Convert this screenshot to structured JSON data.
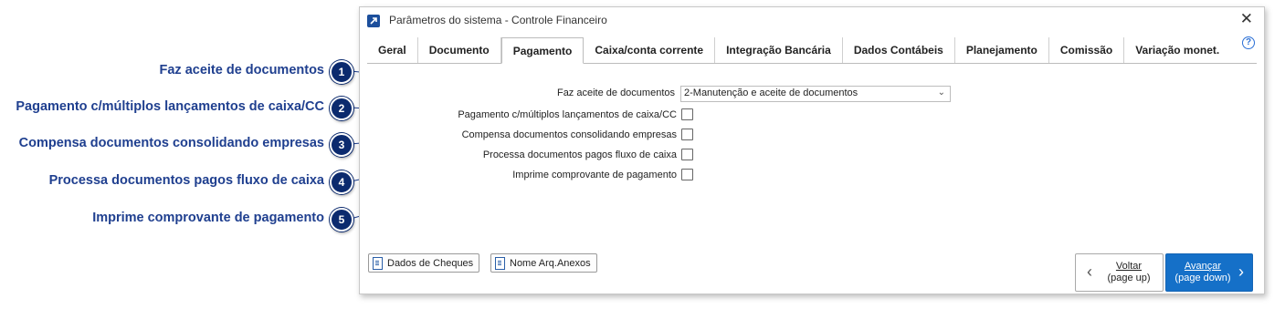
{
  "callouts": [
    {
      "number": "1",
      "label": "Faz aceite de documentos"
    },
    {
      "number": "2",
      "label": "Pagamento c/múltiplos lançamentos de caixa/CC"
    },
    {
      "number": "3",
      "label": "Compensa documentos consolidando empresas"
    },
    {
      "number": "4",
      "label": "Processa documentos pagos fluxo de caixa"
    },
    {
      "number": "5",
      "label": "Imprime comprovante de pagamento"
    }
  ],
  "window": {
    "title": "Parâmetros do sistema - Controle Financeiro",
    "close_glyph": "✕",
    "help_glyph": "?"
  },
  "tabs": [
    {
      "label": "Geral",
      "active": false
    },
    {
      "label": "Documento",
      "active": false
    },
    {
      "label": "Pagamento",
      "active": true
    },
    {
      "label": "Caixa/conta corrente",
      "active": false
    },
    {
      "label": "Integração Bancária",
      "active": false
    },
    {
      "label": "Dados Contábeis",
      "active": false
    },
    {
      "label": "Planejamento",
      "active": false
    },
    {
      "label": "Comissão",
      "active": false
    },
    {
      "label": "Variação monet.",
      "active": false
    }
  ],
  "form": {
    "faz_aceite_label": "Faz aceite de documentos",
    "faz_aceite_value": "2-Manutenção e aceite de documentos",
    "pagamento_multiplos_label": "Pagamento c/múltiplos lançamentos de caixa/CC",
    "pagamento_multiplos_checked": false,
    "compensa_label": "Compensa documentos consolidando empresas",
    "compensa_checked": false,
    "processa_label": "Processa documentos pagos fluxo de caixa",
    "processa_checked": false,
    "imprime_label": "Imprime comprovante de pagamento",
    "imprime_checked": false
  },
  "footer": {
    "dados_cheques": "Dados de Cheques",
    "nome_arq_anexos": "Nome Arq.Anexos",
    "voltar_line1": "Voltar",
    "voltar_line2": "(page up)",
    "avancar_line1": "Avançar",
    "avancar_line2": "(page down)"
  },
  "colors": {
    "callout_text": "#1f3f8f",
    "badge": "#0b2a6e",
    "primary_button": "#1570c8"
  }
}
